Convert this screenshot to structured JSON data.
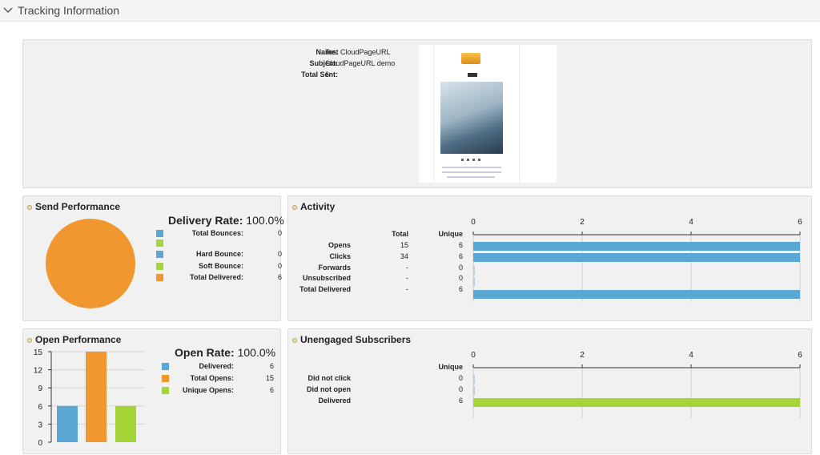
{
  "header": {
    "title": "Tracking Information"
  },
  "summary": {
    "name_label": "Name:",
    "name_value": "Test CloudPageURL",
    "subject_label": "Subject:",
    "subject_value": "CloudPageURL demo",
    "total_sent_label": "Total Sent:",
    "total_sent_value": "6"
  },
  "send_performance": {
    "title": "Send Performance",
    "rate_label": "Delivery Rate:",
    "rate_value": "100.0%",
    "legend": [
      {
        "label": "Total Bounces:",
        "value": "0",
        "color": "#5aa7d3"
      },
      {
        "label": "",
        "value": "",
        "color": "#a6d53a"
      },
      {
        "label": "Hard Bounce:",
        "value": "0",
        "color": "#5aa7d3"
      },
      {
        "label": "Soft Bounce:",
        "value": "0",
        "color": "#a6d53a"
      },
      {
        "label": "Total Delivered:",
        "value": "6",
        "color": "#f0982f"
      }
    ],
    "pie_color": "#f0982f"
  },
  "activity": {
    "title": "Activity",
    "col_total": "Total",
    "col_unique": "Unique",
    "rows": [
      {
        "label": "Opens",
        "total": "15",
        "unique": "6"
      },
      {
        "label": "Clicks",
        "total": "34",
        "unique": "6"
      },
      {
        "label": "Forwards",
        "total": "-",
        "unique": "0"
      },
      {
        "label": "Unsubscribed",
        "total": "-",
        "unique": "0"
      },
      {
        "label": "Total Delivered",
        "total": "-",
        "unique": "6"
      }
    ]
  },
  "open_performance": {
    "title": "Open Performance",
    "rate_label": "Open Rate:",
    "rate_value": "100.0%",
    "legend": [
      {
        "label": "Delivered:",
        "value": "6",
        "color": "#5aa7d3"
      },
      {
        "label": "Total Opens:",
        "value": "15",
        "color": "#f0982f"
      },
      {
        "label": "Unique Opens:",
        "value": "6",
        "color": "#a6d53a"
      }
    ]
  },
  "unengaged": {
    "title": "Unengaged Subscribers",
    "col_unique": "Unique",
    "rows": [
      {
        "label": "Did not click",
        "unique": "0"
      },
      {
        "label": "Did not open",
        "unique": "0"
      },
      {
        "label": "Delivered",
        "unique": "6"
      }
    ]
  },
  "chart_data": [
    {
      "type": "bar",
      "orientation": "horizontal",
      "categories": [
        "Opens",
        "Clicks",
        "Forwards",
        "Unsubscribed",
        "Total Delivered"
      ],
      "values": [
        6,
        6,
        0,
        0,
        6
      ],
      "xlim": [
        0,
        6
      ],
      "ticks": [
        "0",
        "2",
        "4",
        "6"
      ],
      "color": "#5aa7d3",
      "grid": true
    },
    {
      "type": "bar",
      "categories": [
        "Delivered",
        "Total Opens",
        "Unique Opens"
      ],
      "values": [
        6,
        15,
        6
      ],
      "ylim": [
        0,
        15
      ],
      "ticks": [
        "0",
        "3",
        "6",
        "9",
        "12",
        "15"
      ],
      "colors": [
        "#5aa7d3",
        "#f0982f",
        "#a6d53a"
      ],
      "grid": true
    },
    {
      "type": "bar",
      "orientation": "horizontal",
      "categories": [
        "Did not click",
        "Did not open",
        "Delivered"
      ],
      "values": [
        0,
        0,
        6
      ],
      "xlim": [
        0,
        6
      ],
      "ticks": [
        "0",
        "2",
        "4",
        "6"
      ],
      "color": "#a6d53a",
      "grid": true
    }
  ]
}
